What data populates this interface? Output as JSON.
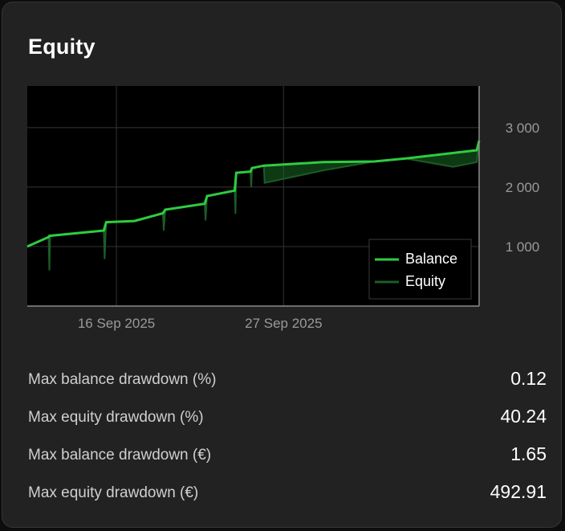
{
  "card": {
    "title": "Equity"
  },
  "chart_data": {
    "type": "line",
    "x_ticks": [
      "16 Sep 2025",
      "27 Sep 2025"
    ],
    "y_ticks": [
      "3 000",
      "2 000",
      "1 000"
    ],
    "y_tick_values": [
      3000,
      2000,
      1000
    ],
    "ylim": [
      0,
      3700
    ],
    "legend": {
      "position": "bottom-right",
      "items": [
        "Balance",
        "Equity"
      ]
    },
    "grid": true,
    "colors": {
      "balance": "#2ecc40",
      "equity": "#1c5c28"
    },
    "series": [
      {
        "name": "Balance",
        "points": [
          [
            0,
            1000
          ],
          [
            27,
            1160
          ],
          [
            28,
            1180
          ],
          [
            97,
            1270
          ],
          [
            100,
            1410
          ],
          [
            136,
            1430
          ],
          [
            172,
            1560
          ],
          [
            175,
            1620
          ],
          [
            225,
            1720
          ],
          [
            228,
            1850
          ],
          [
            263,
            1940
          ],
          [
            265,
            2240
          ],
          [
            283,
            2260
          ],
          [
            285,
            2320
          ],
          [
            300,
            2360
          ],
          [
            375,
            2420
          ],
          [
            440,
            2430
          ],
          [
            480,
            2480
          ],
          [
            570,
            2620
          ],
          [
            573,
            2780
          ]
        ]
      },
      {
        "name": "Equity",
        "points": [
          [
            0,
            1000
          ],
          [
            27,
            1160
          ],
          [
            28,
            600
          ],
          [
            29,
            1180
          ],
          [
            97,
            1270
          ],
          [
            98,
            790
          ],
          [
            100,
            1410
          ],
          [
            136,
            1430
          ],
          [
            172,
            1560
          ],
          [
            173,
            1270
          ],
          [
            175,
            1620
          ],
          [
            225,
            1720
          ],
          [
            226,
            1440
          ],
          [
            228,
            1850
          ],
          [
            263,
            1940
          ],
          [
            264,
            1550
          ],
          [
            265,
            2240
          ],
          [
            283,
            2260
          ],
          [
            284,
            2000
          ],
          [
            285,
            2320
          ],
          [
            300,
            2360
          ],
          [
            301,
            2070
          ],
          [
            375,
            2280
          ],
          [
            440,
            2430
          ],
          [
            480,
            2480
          ],
          [
            540,
            2340
          ],
          [
            570,
            2420
          ],
          [
            573,
            2780
          ]
        ]
      }
    ]
  },
  "stats": [
    {
      "label": "Max balance drawdown (%)",
      "value": "0.12"
    },
    {
      "label": "Max equity drawdown (%)",
      "value": "40.24"
    },
    {
      "label": "Max balance drawdown (€)",
      "value": "1.65"
    },
    {
      "label": "Max equity drawdown (€)",
      "value": "492.91"
    }
  ]
}
